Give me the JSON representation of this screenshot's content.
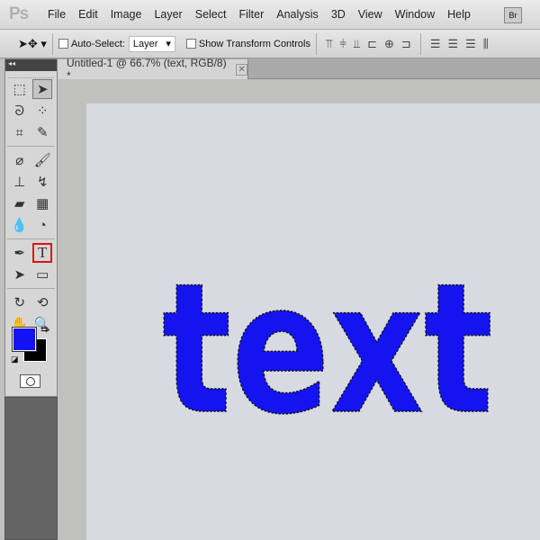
{
  "app": {
    "logo": "Ps",
    "bridge": "Br"
  },
  "menu": [
    "File",
    "Edit",
    "Image",
    "Layer",
    "Select",
    "Filter",
    "Analysis",
    "3D",
    "View",
    "Window",
    "Help"
  ],
  "options": {
    "auto_select_label": "Auto-Select:",
    "auto_select_checked": false,
    "layer_select": "Layer",
    "show_transform_label": "Show Transform Controls",
    "show_transform_checked": false
  },
  "document": {
    "tab_title": "Untitled-1 @ 66.7% (text, RGB/8) *",
    "canvas_text": "text"
  },
  "colors": {
    "foreground": "#1212f5",
    "background": "#000000",
    "text_fill": "#1414f0",
    "highlight": "#e0111a"
  },
  "toolbox": {
    "active_tool": "move-tool",
    "highlighted_tool": "type-tool"
  }
}
